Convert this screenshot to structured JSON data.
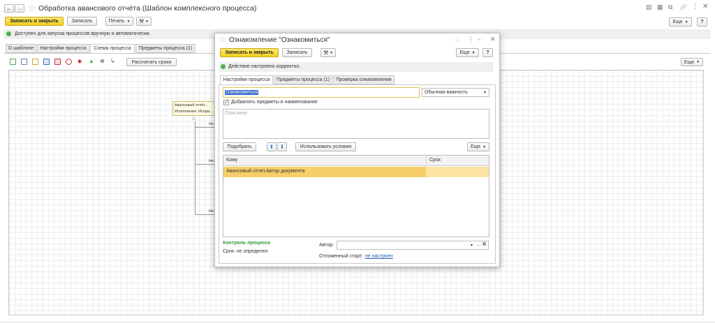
{
  "window": {
    "title": "Обработка авансового отчёта (Шаблон комплексного процесса)",
    "buttons": {
      "save_close": "Записать и закрыть",
      "save": "Записать",
      "print": "Печать",
      "more": "Еще",
      "help": "?",
      "more_right": "Еще"
    },
    "status": "Доступен для запуска процессов вручную и автоматически.",
    "tabs": [
      {
        "label": "О шаблоне"
      },
      {
        "label": "Настройки процесса"
      },
      {
        "label": "Схема процесса"
      },
      {
        "label": "Предметы процесса (1)"
      }
    ],
    "calc_button": "Рассчитать сроки",
    "scheme": {
      "block_line1": "Авансовый отчёт...",
      "block_line2": "Исполнение: Испра...",
      "labels": [
        "Не",
        "Не",
        "Не"
      ]
    }
  },
  "dialog": {
    "title": "Ознакомление \"Ознакомиться\"",
    "buttons": {
      "save_close": "Записать и закрыть",
      "save": "Записать",
      "more": "Еще",
      "help": "?"
    },
    "status": "Действие настроено корректно.",
    "tabs": [
      {
        "label": "Настройки процесса"
      },
      {
        "label": "Предметы процесса (1)"
      },
      {
        "label": "Проверка ознакомления"
      }
    ],
    "name_value": "Ознакомиться",
    "importance": "Обычная важность",
    "add_subjects_checkbox": "Добавлять предметы в наименование",
    "description_placeholder": "Описание",
    "pick_button": "Подобрать",
    "use_conditions_button": "Использовать условия",
    "more_table": "Еще",
    "table": {
      "columns": [
        "Кому",
        "Срок"
      ],
      "rows": [
        {
          "to": "Авансовый отчёт.Автор документа",
          "deadline": ""
        }
      ]
    },
    "control_title": "Контроль процесса",
    "deadline_label": "Срок: не определен",
    "author_label": "Автор:",
    "deferred_label": "Отложенный старт:",
    "deferred_link": "не настроен"
  }
}
